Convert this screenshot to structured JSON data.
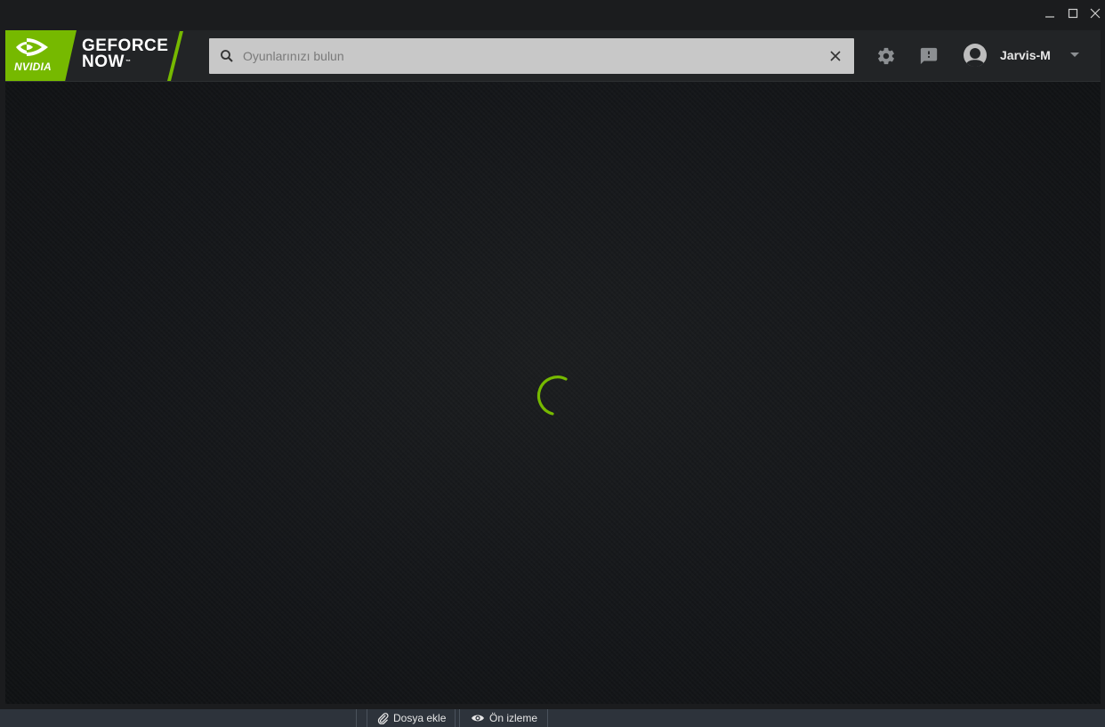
{
  "window": {
    "controls": [
      "minimize-icon",
      "maximize-icon",
      "close-icon"
    ]
  },
  "header": {
    "brand": {
      "nvidia_label": "NVIDIA",
      "line1": "GEFORCE",
      "line2": "NOW",
      "tm": "™",
      "accent_color": "#76b900"
    },
    "search": {
      "placeholder": "Oyunlarınızı bulun",
      "value": ""
    },
    "user": {
      "name": "Jarvis-M"
    },
    "icons": [
      "search-icon",
      "clear-icon",
      "gear-icon",
      "feedback-icon",
      "avatar-icon",
      "chevron-down-icon"
    ]
  },
  "content": {
    "state": "loading",
    "spinner_color": "#76b900"
  },
  "bottombar": {
    "attach_label": "Dosya ekle",
    "preview_label": "Ön izleme"
  }
}
